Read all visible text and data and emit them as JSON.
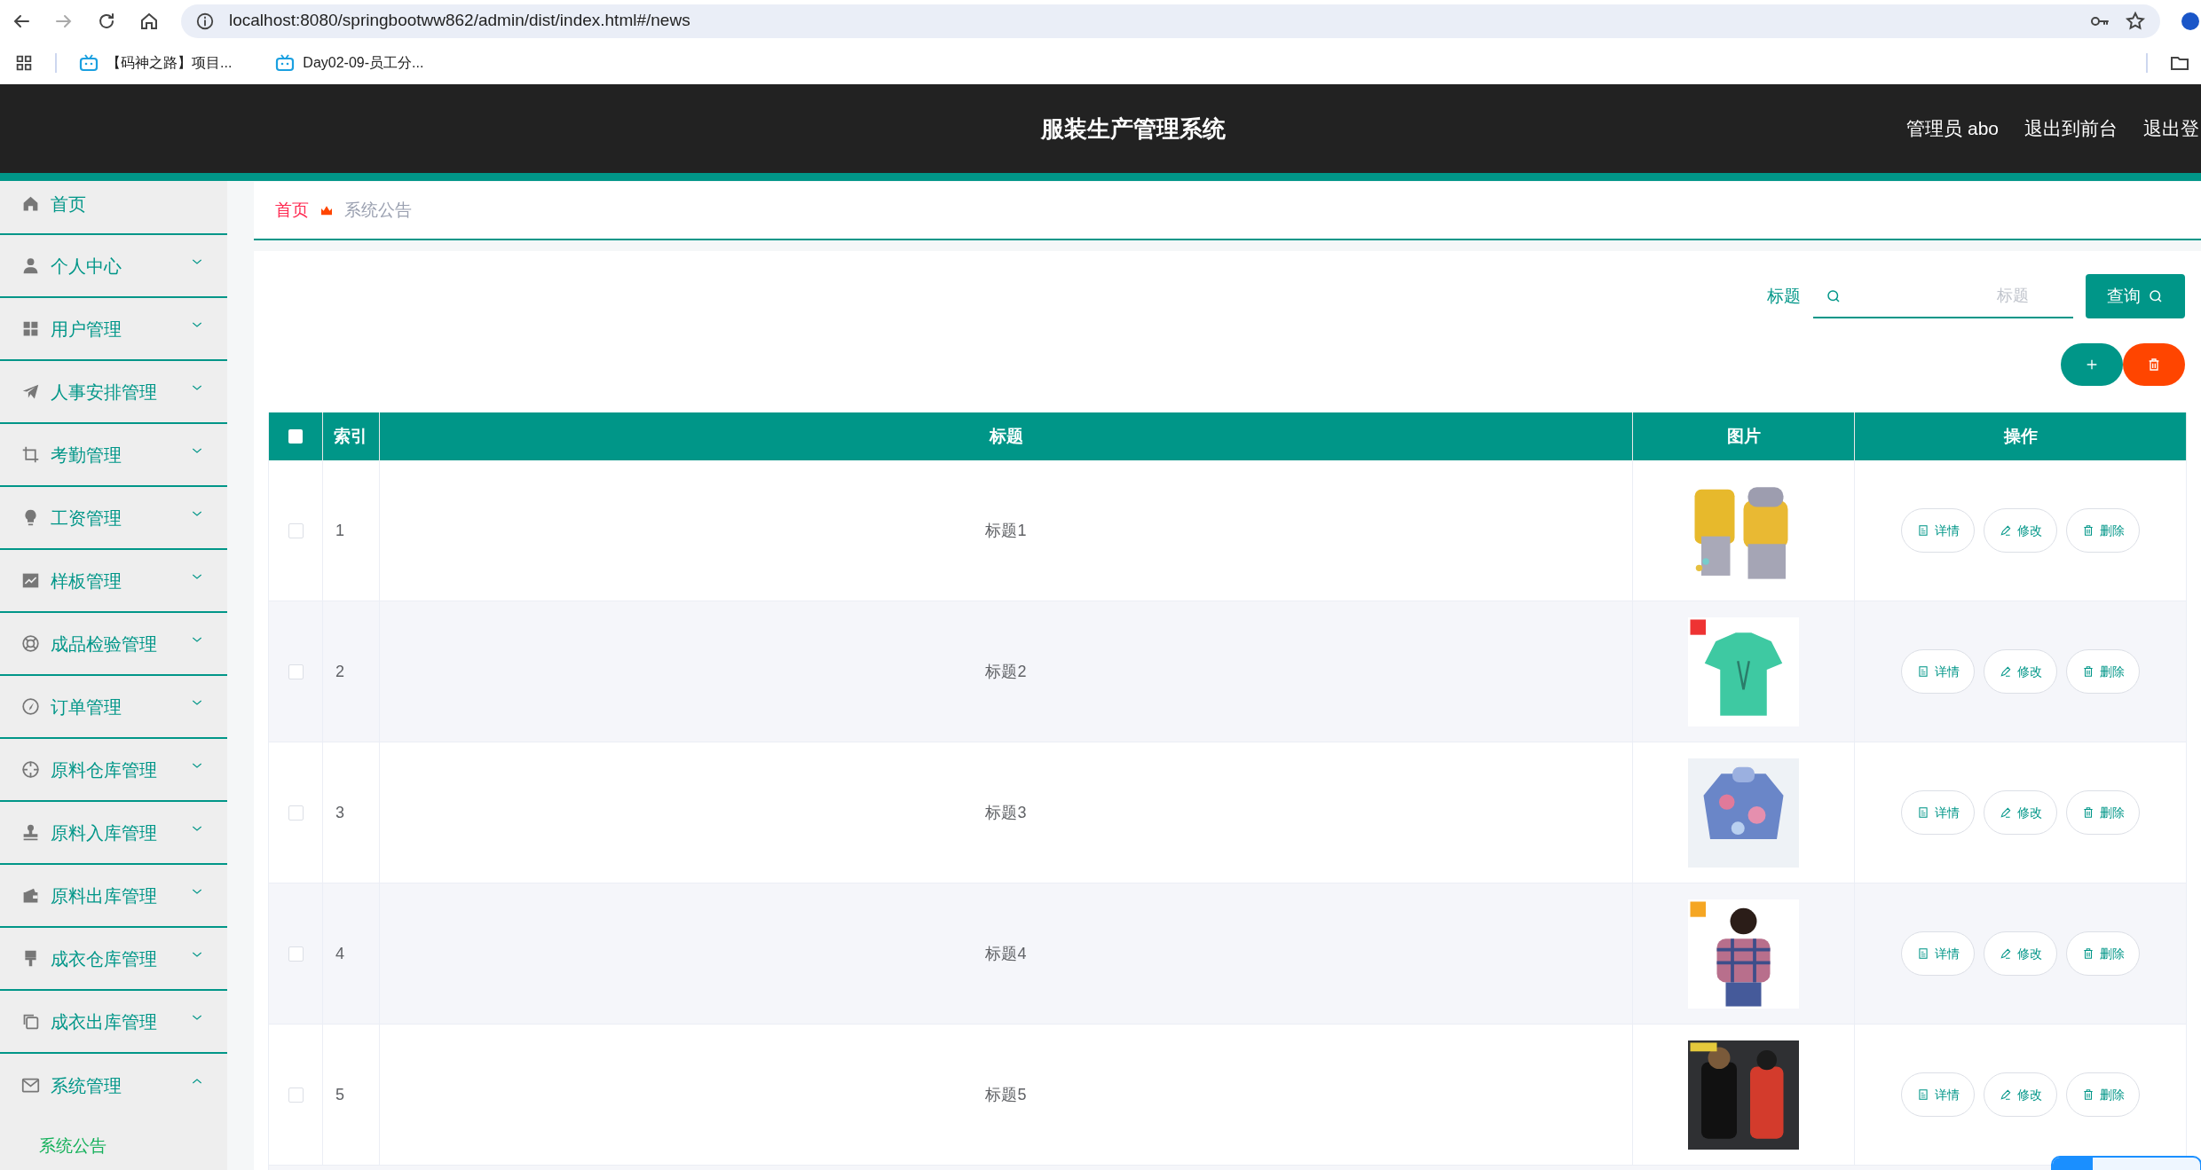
{
  "browser": {
    "url": "localhost:8080/springbootww862/admin/dist/index.html#/news",
    "bookmarks": [
      "【码神之路】项目...",
      "Day02-09-员工分..."
    ]
  },
  "header": {
    "title": "服装生产管理系统",
    "user": "管理员 abo",
    "links": [
      "退出到前台",
      "退出登"
    ]
  },
  "sidebar": {
    "items": [
      {
        "label": "首页",
        "kind": "link"
      },
      {
        "label": "个人中心",
        "kind": "menu",
        "expanded": false
      },
      {
        "label": "用户管理",
        "kind": "menu",
        "expanded": false
      },
      {
        "label": "人事安排管理",
        "kind": "menu",
        "expanded": false
      },
      {
        "label": "考勤管理",
        "kind": "menu",
        "expanded": false
      },
      {
        "label": "工资管理",
        "kind": "menu",
        "expanded": false
      },
      {
        "label": "样板管理",
        "kind": "menu",
        "expanded": false
      },
      {
        "label": "成品检验管理",
        "kind": "menu",
        "expanded": false
      },
      {
        "label": "订单管理",
        "kind": "menu",
        "expanded": false
      },
      {
        "label": "原料仓库管理",
        "kind": "menu",
        "expanded": false
      },
      {
        "label": "原料入库管理",
        "kind": "menu",
        "expanded": false
      },
      {
        "label": "原料出库管理",
        "kind": "menu",
        "expanded": false
      },
      {
        "label": "成衣仓库管理",
        "kind": "menu",
        "expanded": false
      },
      {
        "label": "成衣出库管理",
        "kind": "menu",
        "expanded": false
      },
      {
        "label": "系统管理",
        "kind": "menu",
        "expanded": true,
        "children": [
          {
            "label": "系统公告",
            "selected": true
          }
        ]
      }
    ]
  },
  "breadcrumb": [
    "首页",
    "系统公告"
  ],
  "search": {
    "label": "标题",
    "placeholder": "标题",
    "button": "查询"
  },
  "table": {
    "header_checked": false,
    "columns": [
      "索引",
      "标题",
      "图片",
      "操作"
    ],
    "rows": [
      {
        "checked": false,
        "index": "1",
        "title": "标题1",
        "actions": [
          "详情",
          "修改",
          "删除"
        ]
      },
      {
        "checked": false,
        "index": "2",
        "title": "标题2",
        "actions": [
          "详情",
          "修改",
          "删除"
        ]
      },
      {
        "checked": false,
        "index": "3",
        "title": "标题3",
        "actions": [
          "详情",
          "修改",
          "删除"
        ]
      },
      {
        "checked": false,
        "index": "4",
        "title": "标题4",
        "actions": [
          "详情",
          "修改",
          "删除"
        ]
      },
      {
        "checked": false,
        "index": "5",
        "title": "标题5",
        "actions": [
          "详情",
          "修改",
          "删除"
        ]
      }
    ]
  }
}
